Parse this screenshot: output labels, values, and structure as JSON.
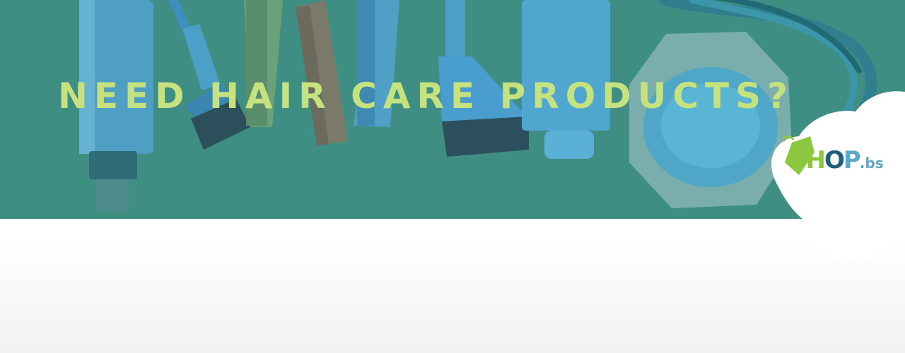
{
  "banner": {
    "headline": "NEED HAIR CARE PRODUCTS?"
  },
  "logo": {
    "text_main": "SHOP",
    "text_s": "S",
    "text_h": "H",
    "text_o": "O",
    "text_p": "P",
    "text_suffix": ".bs"
  },
  "colors": {
    "banner_bg": "#3f8e84",
    "headline": "#c5e27f",
    "logo_green": "#8dc63f",
    "logo_navy": "#1d5f7a",
    "logo_blue": "#5aa9c9"
  },
  "icons": [
    "hair-bottle-icon",
    "dye-brush-icon",
    "comb-icon",
    "tube-icon",
    "hair-mask-jar-icon",
    "price-tag-icon"
  ]
}
